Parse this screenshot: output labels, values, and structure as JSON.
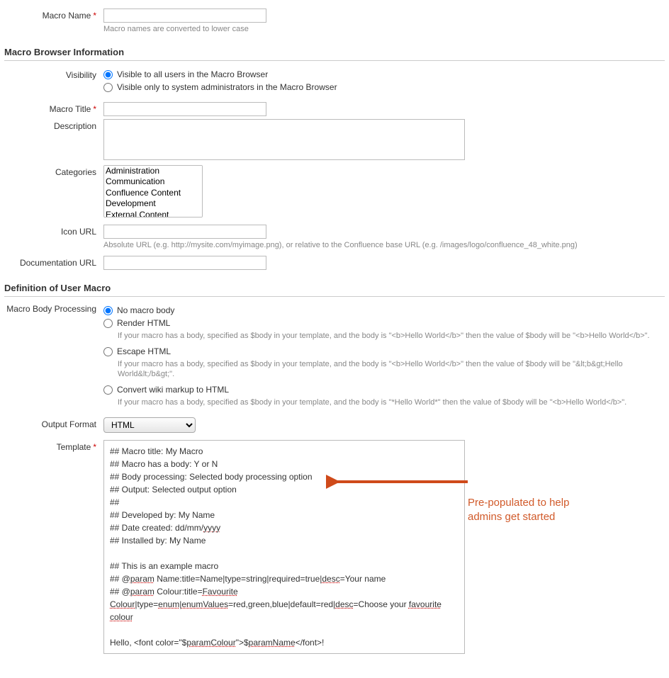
{
  "fields": {
    "macroName": {
      "label": "Macro Name",
      "required": true,
      "hint": "Macro names are converted to lower case",
      "value": ""
    },
    "macroTitle": {
      "label": "Macro Title",
      "required": true,
      "value": ""
    },
    "description": {
      "label": "Description",
      "value": ""
    },
    "categories": {
      "label": "Categories",
      "options": [
        "Administration",
        "Communication",
        "Confluence Content",
        "Development",
        "External Content"
      ]
    },
    "iconUrl": {
      "label": "Icon URL",
      "value": "",
      "hint": "Absolute URL (e.g. http://mysite.com/myimage.png), or relative to the Confluence base URL (e.g. /images/logo/confluence_48_white.png)"
    },
    "docUrl": {
      "label": "Documentation URL",
      "value": ""
    },
    "outputFormat": {
      "label": "Output Format",
      "value": "HTML"
    },
    "template": {
      "label": "Template",
      "required": true
    }
  },
  "sections": {
    "browser": "Macro Browser Information",
    "definition": "Definition of User Macro"
  },
  "visibility": {
    "label": "Visibility",
    "options": [
      {
        "label": "Visible to all users in the Macro Browser",
        "checked": true
      },
      {
        "label": "Visible only to system administrators in the Macro Browser",
        "checked": false
      }
    ]
  },
  "bodyProcessing": {
    "label": "Macro Body Processing",
    "options": [
      {
        "label": "No macro body",
        "checked": true,
        "hint": ""
      },
      {
        "label": "Render HTML",
        "checked": false,
        "hint": "If your macro has a body, specified as $body in your template, and the body is \"<b>Hello World</b>\" then the value of $body will be \"<b>Hello World</b>\"."
      },
      {
        "label": "Escape HTML",
        "checked": false,
        "hint": "If your macro has a body, specified as $body in your template, and the body is \"<b>Hello World</b>\" then the value of $body will be \"&lt;b&gt;Hello World&lt;/b&gt;\"."
      },
      {
        "label": "Convert wiki markup to HTML",
        "checked": false,
        "hint": "If your macro has a body, specified as $body in your template, and the body is \"*Hello World*\" then the value of $body will be \"<b>Hello World</b>\"."
      }
    ]
  },
  "templateLines": {
    "l1a": "## Macro title: My Macro",
    "l2a": "## Macro has a body: Y or N",
    "l3a": "## Body processing: Selected body processing option",
    "l4a": "## Output: Selected output option",
    "l5a": "##",
    "l6a": "## Developed by: My Name",
    "l7a": "## Date created: dd/mm/",
    "l7b": "yyyy",
    "l8a": "## Installed by: My Name",
    "l10a": "## This is an example macro",
    "l11a": "## @",
    "l11b": "param",
    "l11c": " Name:title=Name|type=string|required=true|",
    "l11d": "desc",
    "l11e": "=Your name",
    "l12a": "## @",
    "l12b": "param",
    "l12c": " Colour:title=",
    "l12d": "Favourite",
    "l13a": "Colour",
    "l13b": "|type=",
    "l13c": "enum",
    "l13d": "|",
    "l13e": "enumValues",
    "l13f": "=red,green,blue|default=red|",
    "l13g": "desc",
    "l13h": "=Choose your ",
    "l13i": "favourite",
    "l13j": " ",
    "l13k": "colour",
    "l15a": "Hello, <font color=\"$",
    "l15b": "paramColour",
    "l15c": "\">$",
    "l15d": "paramName",
    "l15e": "</font>!"
  },
  "annotation": "Pre-populated to help\nadmins get started"
}
